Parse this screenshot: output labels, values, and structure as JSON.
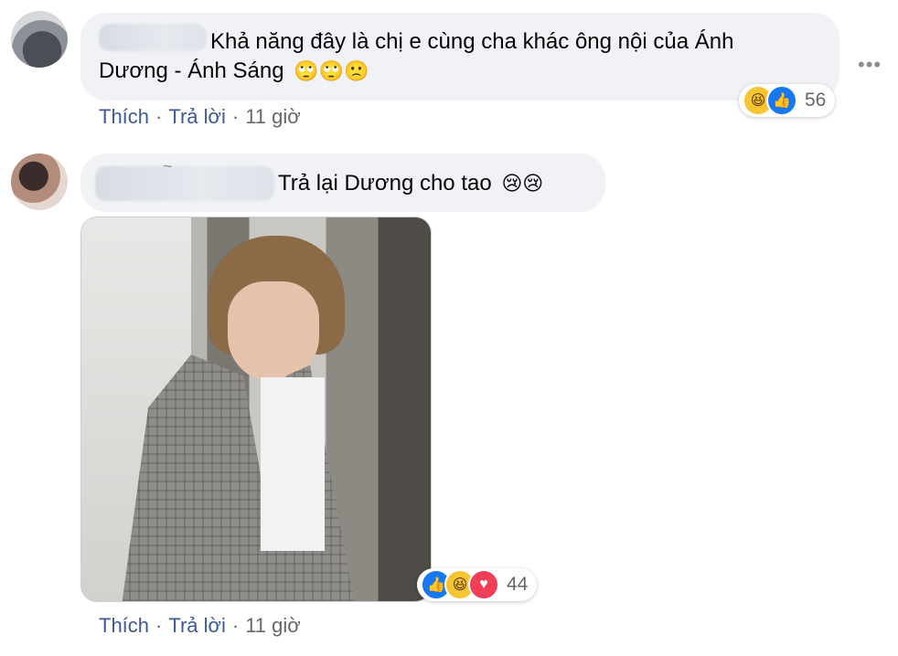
{
  "comments": [
    {
      "text_line1": "Khả năng đây là chị e cùng cha khác ông nội của Ánh",
      "text_line2": "Dương - Ánh Sáng",
      "emojis": "🙄🙄🙁",
      "reactions": {
        "icons": [
          "haha",
          "like"
        ],
        "count": "56"
      },
      "meta": {
        "like": "Thích",
        "reply": "Trả lời",
        "time": "11 giờ"
      }
    },
    {
      "text": "Trả lại Dương cho tao",
      "emojis": "😢😢",
      "name_mark": "~",
      "reactions": {
        "icons": [
          "like",
          "haha",
          "love"
        ],
        "count": "44"
      },
      "meta": {
        "like": "Thích",
        "reply": "Trả lời",
        "time": "11 giờ"
      }
    }
  ],
  "icons": {
    "more": "more-options-icon",
    "haha": "haha-reaction-icon",
    "like": "like-reaction-icon",
    "love": "love-reaction-icon"
  },
  "colors": {
    "bubble": "#f0f2f5",
    "link": "#3b5a99",
    "meta": "#65676b",
    "like": "#1877f2",
    "love": "#f33e58",
    "haha": "#f7c531"
  }
}
